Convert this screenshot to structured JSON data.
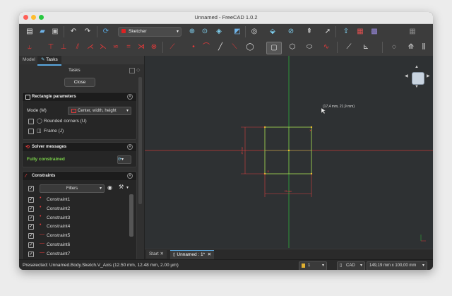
{
  "window": {
    "title": "Unnamed - FreeCAD 1.0.2"
  },
  "colors": {
    "titlebar": "#e8e8e8",
    "toolbar": "#3c3c3c",
    "panel": "#262626",
    "viewport": "#2e3133",
    "sketch_green": "#9ed050",
    "axis_red": "#c23838",
    "dimension_red": "#d84040",
    "constraint_red": "#e23a3a",
    "accent_green": "#7bd24a"
  },
  "toolbar": {
    "workbench": "Sketcher",
    "row1_icons": [
      "new-icon",
      "open-icon",
      "save-icon",
      "undo-icon",
      "redo-icon",
      "refresh-icon",
      "fit-all-icon",
      "fit-selection-icon",
      "view-box-icon",
      "measure-icon",
      "draw-style-icon",
      "std-views-icon",
      "zoom-icon",
      "select-icon",
      "pointer-icon",
      "export-icon",
      "macro-icon",
      "sketch-view-icon",
      "grid-icon"
    ],
    "row2_icons": [
      "polyline-icon",
      "line-icon",
      "constrain-perpendicular-icon",
      "constrain-parallel-icon",
      "constrain-tangent-icon",
      "constrain-equal-icon",
      "constrain-symmetric-icon",
      "constrain-block-icon",
      "constrain-distance-icon",
      "point-icon",
      "arc-icon",
      "line-tool-icon",
      "polyline-tool-icon",
      "circle-icon",
      "rectangle-icon",
      "polygon-icon",
      "slot-icon",
      "bspline-icon",
      "construction-icon",
      "external-icon",
      "offset-icon",
      "trim-icon",
      "mirror-icon"
    ]
  },
  "tabs": {
    "model": "Model",
    "tasks": "Tasks"
  },
  "tasks": {
    "title": "Tasks",
    "close_label": "Close"
  },
  "rectangle_params": {
    "title": "Rectangle parameters",
    "mode_label": "Mode (M)",
    "mode_value": "Center, width, height",
    "rounded_label": "Rounded corners (U)",
    "frame_label": "Frame (J)"
  },
  "solver": {
    "title": "Solver messages",
    "status": "Fully constrained"
  },
  "constraints": {
    "title": "Constraints",
    "filter_label": "Filters",
    "items": [
      "Constraint1",
      "Constraint2",
      "Constraint3",
      "Constraint4",
      "Constraint5",
      "Constraint6",
      "Constraint7"
    ]
  },
  "viewport": {
    "cursor_coords": "(17,4 mm, 21,9 mm)",
    "dim_width": "25 mm",
    "dim_height": "25 mm"
  },
  "doc_tabs": {
    "start": "Start",
    "doc": "Unnamed : 1*"
  },
  "status": {
    "preselect": "Preselected: Unnamed.Body.Sketch.V_Axis (12.50 mm, 12.48 mm, 2.00 µm)",
    "layer": "1",
    "nav_style": "CAD",
    "dims": "149,19 mm x 100,00 mm"
  }
}
